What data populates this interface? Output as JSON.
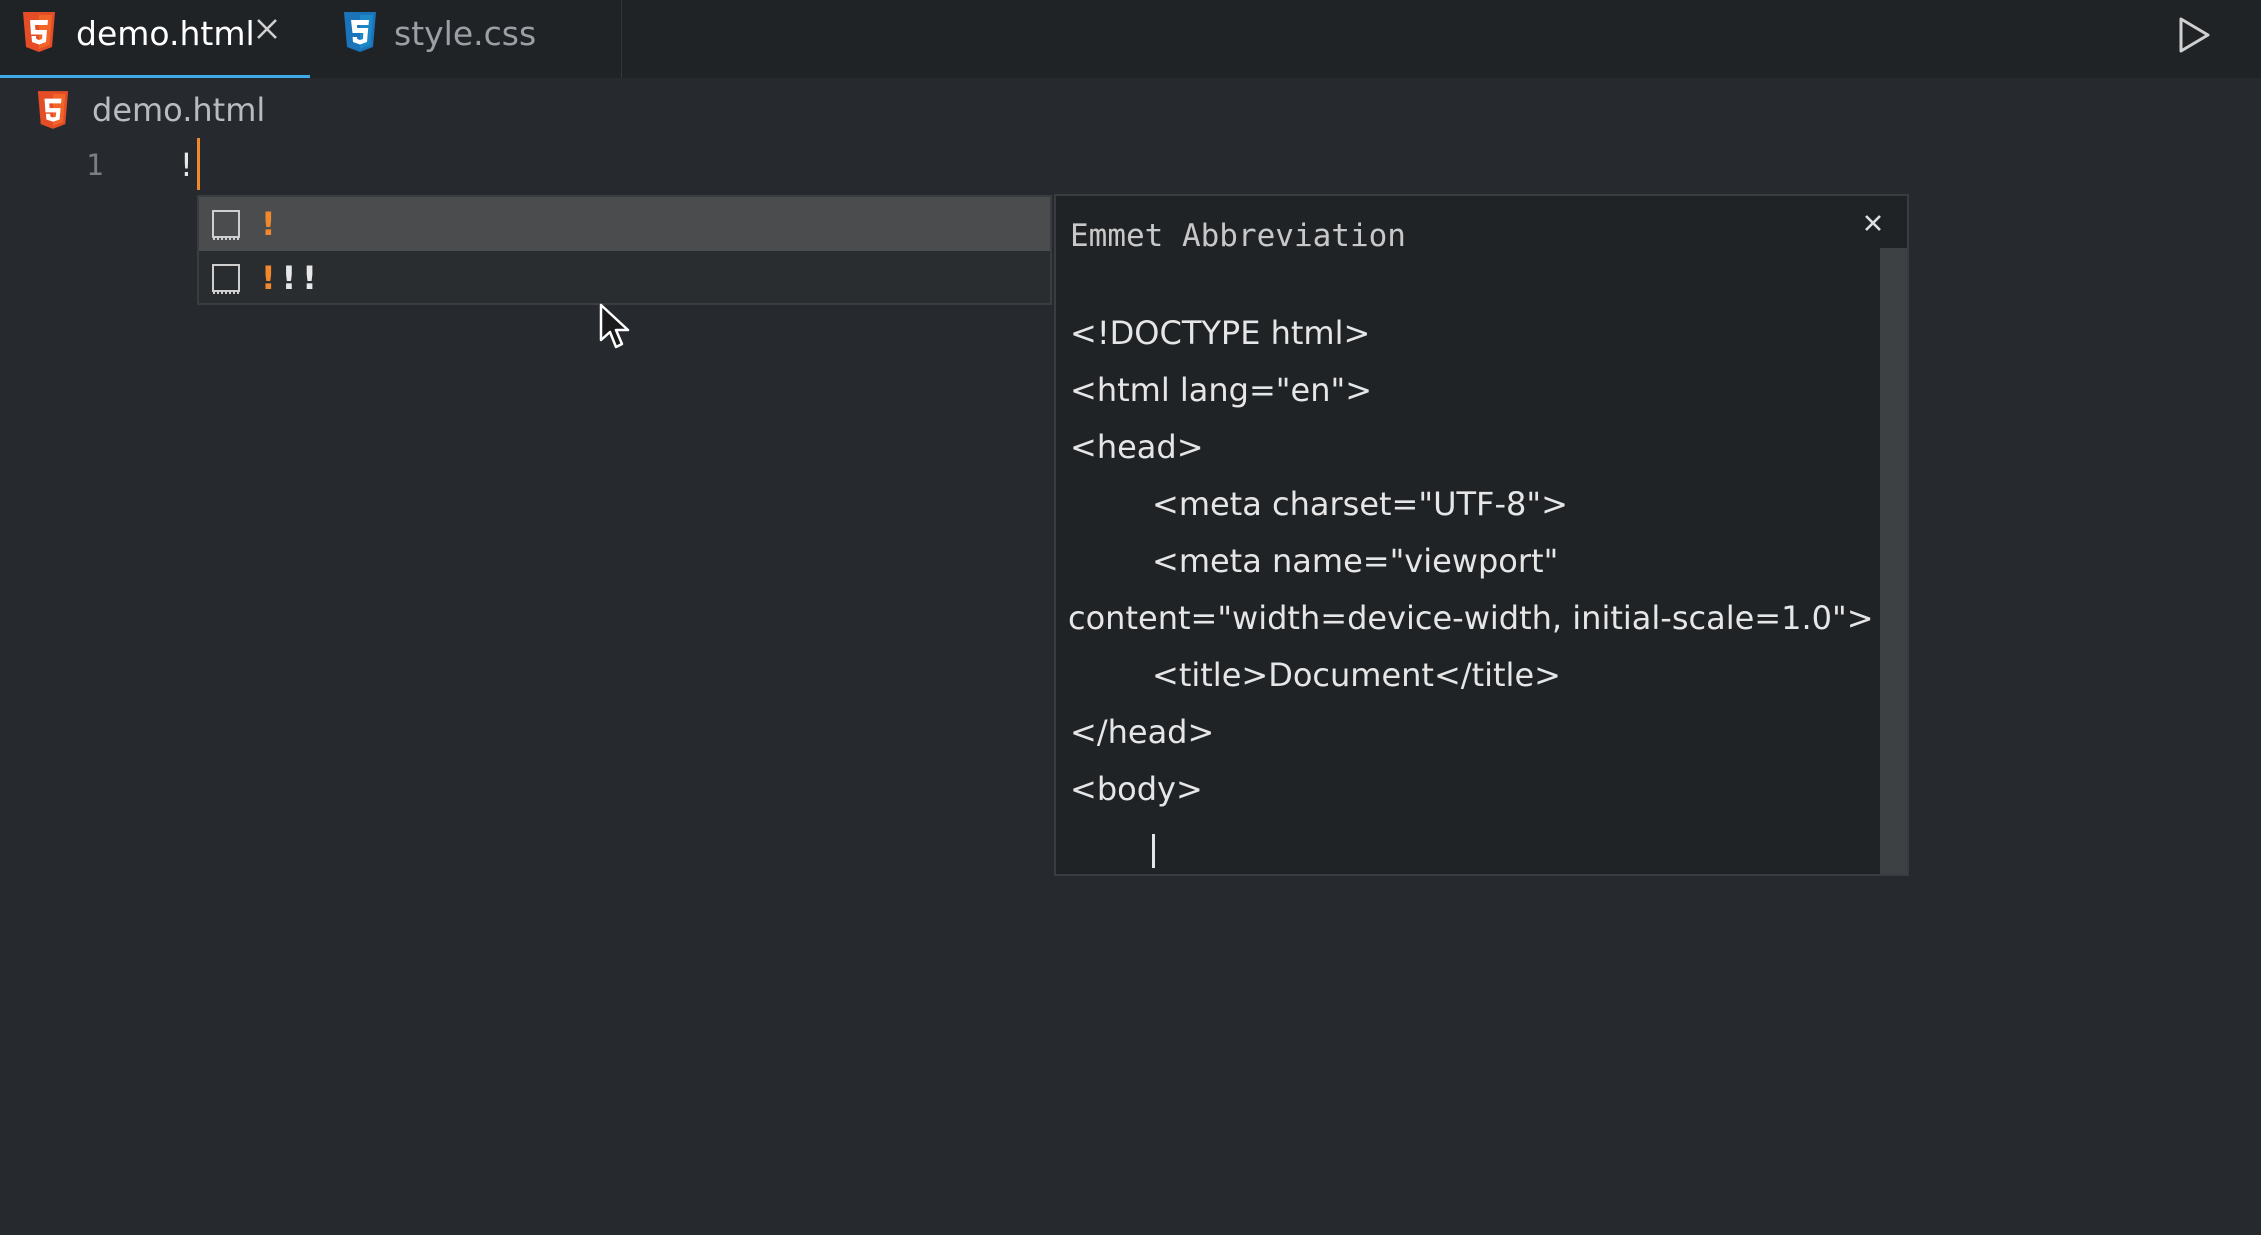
{
  "tabs": [
    {
      "label": "demo.html",
      "icon": "html5-icon",
      "active": true
    },
    {
      "label": "style.css",
      "icon": "css3-icon",
      "active": false
    }
  ],
  "breadcrumb": {
    "file": "demo.html",
    "icon": "html5-icon"
  },
  "editor": {
    "line_number": "1",
    "line_text": "!"
  },
  "suggestions": [
    {
      "highlight": "!",
      "rest": "",
      "selected": true
    },
    {
      "highlight": "!",
      "rest": "!!",
      "selected": false
    }
  ],
  "doc_panel": {
    "title": "Emmet Abbreviation",
    "lines": [
      "<!DOCTYPE html>",
      "<html lang=\"en\">",
      "<head>",
      "<meta charset=\"UTF-8\">",
      "<meta name=\"viewport\"",
      "content=\"width=device-width, initial-scale=1.0\">",
      "<title>Document</title>",
      "</head>",
      "<body>"
    ]
  },
  "colors": {
    "html_icon": "#e44d26",
    "css_icon": "#1b73ba",
    "accent": "#3ea9e6",
    "match_highlight": "#f0892e"
  }
}
